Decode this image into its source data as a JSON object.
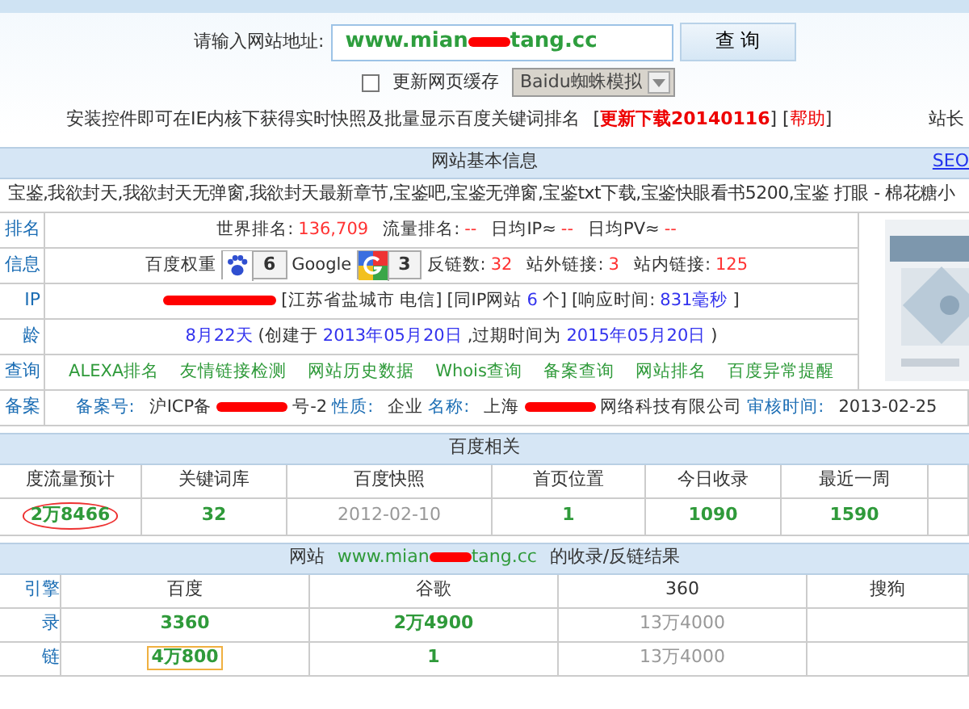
{
  "query": {
    "label": "请输入网站地址:",
    "url_start": "www.mian",
    "url_end": "tang.cc",
    "button": "查 询"
  },
  "options": {
    "cache_checkbox": {
      "label": "更新网页缓存",
      "checked": false
    },
    "spider_select": "Baidu蜘蛛模拟"
  },
  "notice": {
    "text": "安装控件即可在IE内核下获得实时快照及批量显示百度关键词排名",
    "open_bracket": "[",
    "download_link": "更新下载20140116",
    "middle_bracket": "] [",
    "help_link": "帮助",
    "close_bracket": "]",
    "right_text": "站长"
  },
  "basic_info": {
    "title": "网站基本信息",
    "seo_link": "SEO",
    "keywords": "宝鉴,我欲封天,我欲封天无弹窗,我欲封天最新章节,宝鉴吧,宝鉴无弹窗,宝鉴txt下载,宝鉴快眼看书5200,宝鉴 打眼 - 棉花糖小",
    "rows": [
      {
        "label": "排名",
        "items": [
          {
            "kind": "text",
            "text": "世界排名:"
          },
          {
            "kind": "red",
            "text": "136,709"
          },
          {
            "kind": "text",
            "text": "流量排名:"
          },
          {
            "kind": "red",
            "text": "--"
          },
          {
            "kind": "text",
            "text": "日均IP≈"
          },
          {
            "kind": "red",
            "text": "--"
          },
          {
            "kind": "text",
            "text": "日均PV≈"
          },
          {
            "kind": "red",
            "text": "--"
          }
        ]
      },
      {
        "label": "信息",
        "items": [
          {
            "kind": "text",
            "text": "百度权重"
          },
          {
            "kind": "badge",
            "text": "6"
          },
          {
            "kind": "text",
            "text": "Google"
          },
          {
            "kind": "badge",
            "text": "3"
          },
          {
            "kind": "text",
            "text": "反链数:"
          },
          {
            "kind": "red",
            "text": "32"
          },
          {
            "kind": "text",
            "text": "站外链接:"
          },
          {
            "kind": "red",
            "text": "3"
          },
          {
            "kind": "text",
            "text": "站内链接:"
          },
          {
            "kind": "red",
            "text": "125"
          }
        ]
      },
      {
        "label": "IP",
        "items": [
          {
            "kind": "redaction"
          },
          {
            "kind": "text",
            "text": "[江苏省盐城市 电信]"
          },
          {
            "kind": "text",
            "text": "[同IP网站"
          },
          {
            "kind": "blue",
            "text": "6"
          },
          {
            "kind": "text",
            "text": "个]"
          },
          {
            "kind": "text",
            "text": "[响应时间:"
          },
          {
            "kind": "blue",
            "text": "831毫秒"
          },
          {
            "kind": "text",
            "text": "]"
          }
        ]
      },
      {
        "label": "龄",
        "items": [
          {
            "kind": "blue",
            "text": "8月22天"
          },
          {
            "kind": "text",
            "text": "(创建于"
          },
          {
            "kind": "blue",
            "text": "2013年05月20日"
          },
          {
            "kind": "text",
            "text": ",过期时间为"
          },
          {
            "kind": "blue",
            "text": "2015年05月20日"
          },
          {
            "kind": "text",
            "text": ")"
          }
        ]
      },
      {
        "label": "查询",
        "items": [
          {
            "kind": "link",
            "text": "ALEXA排名"
          },
          {
            "kind": "link",
            "text": "友情链接检测"
          },
          {
            "kind": "link",
            "text": "网站历史数据"
          },
          {
            "kind": "link",
            "text": "Whois查询"
          },
          {
            "kind": "link",
            "text": "备案查询"
          },
          {
            "kind": "link",
            "text": "网站排名"
          },
          {
            "kind": "link",
            "text": "百度异常提醒"
          }
        ]
      },
      {
        "label": "备案",
        "items": [
          {
            "kind": "field",
            "text": "备案号:"
          },
          {
            "kind": "text",
            "text": "沪ICP备"
          },
          {
            "kind": "redaction"
          },
          {
            "kind": "text",
            "text": "号-2"
          },
          {
            "kind": "field",
            "text": "性质:"
          },
          {
            "kind": "text",
            "text": "企业"
          },
          {
            "kind": "field",
            "text": "名称:"
          },
          {
            "kind": "text",
            "text": "上海"
          },
          {
            "kind": "redaction"
          },
          {
            "kind": "text",
            "text": "网络科技有限公司"
          },
          {
            "kind": "field",
            "text": "审核时间:"
          },
          {
            "kind": "text",
            "text": "2013-02-25"
          }
        ]
      }
    ]
  },
  "baidu": {
    "title": "百度相关",
    "columns": [
      "度流量预计",
      "关键词库",
      "百度快照",
      "首页位置",
      "今日收录",
      "最近一周"
    ],
    "values": [
      {
        "kind": "green",
        "text": "2万8466",
        "circled": true
      },
      {
        "kind": "green",
        "text": "32",
        "circled": false
      },
      {
        "kind": "gray",
        "text": "2012-02-10",
        "circled": false
      },
      {
        "kind": "green",
        "text": "1",
        "circled": false
      },
      {
        "kind": "green",
        "text": "1090",
        "circled": false
      },
      {
        "kind": "green",
        "text": "1590",
        "circled": false
      }
    ]
  },
  "results": {
    "title_start": "网站",
    "url_start": "www.mian",
    "url_end": "tang.cc",
    "title_end": "的收录/反链结果",
    "columns": [
      "引擎",
      "百度",
      "谷歌",
      "360",
      "搜狗"
    ],
    "rows": [
      {
        "cells": [
          {
            "kind": "label",
            "text": "录",
            "boxed": false
          },
          {
            "kind": "green",
            "text": "3360",
            "boxed": false
          },
          {
            "kind": "green",
            "text": "2万4900",
            "boxed": false
          },
          {
            "kind": "gray",
            "text": "13万4000",
            "boxed": false
          }
        ]
      },
      {
        "cells": [
          {
            "kind": "label",
            "text": "链",
            "boxed": false
          },
          {
            "kind": "green",
            "text": "4万800",
            "boxed": true
          },
          {
            "kind": "green",
            "text": "1",
            "boxed": false
          },
          {
            "kind": "gray",
            "text": "13万4000",
            "boxed": false
          }
        ]
      }
    ]
  }
}
